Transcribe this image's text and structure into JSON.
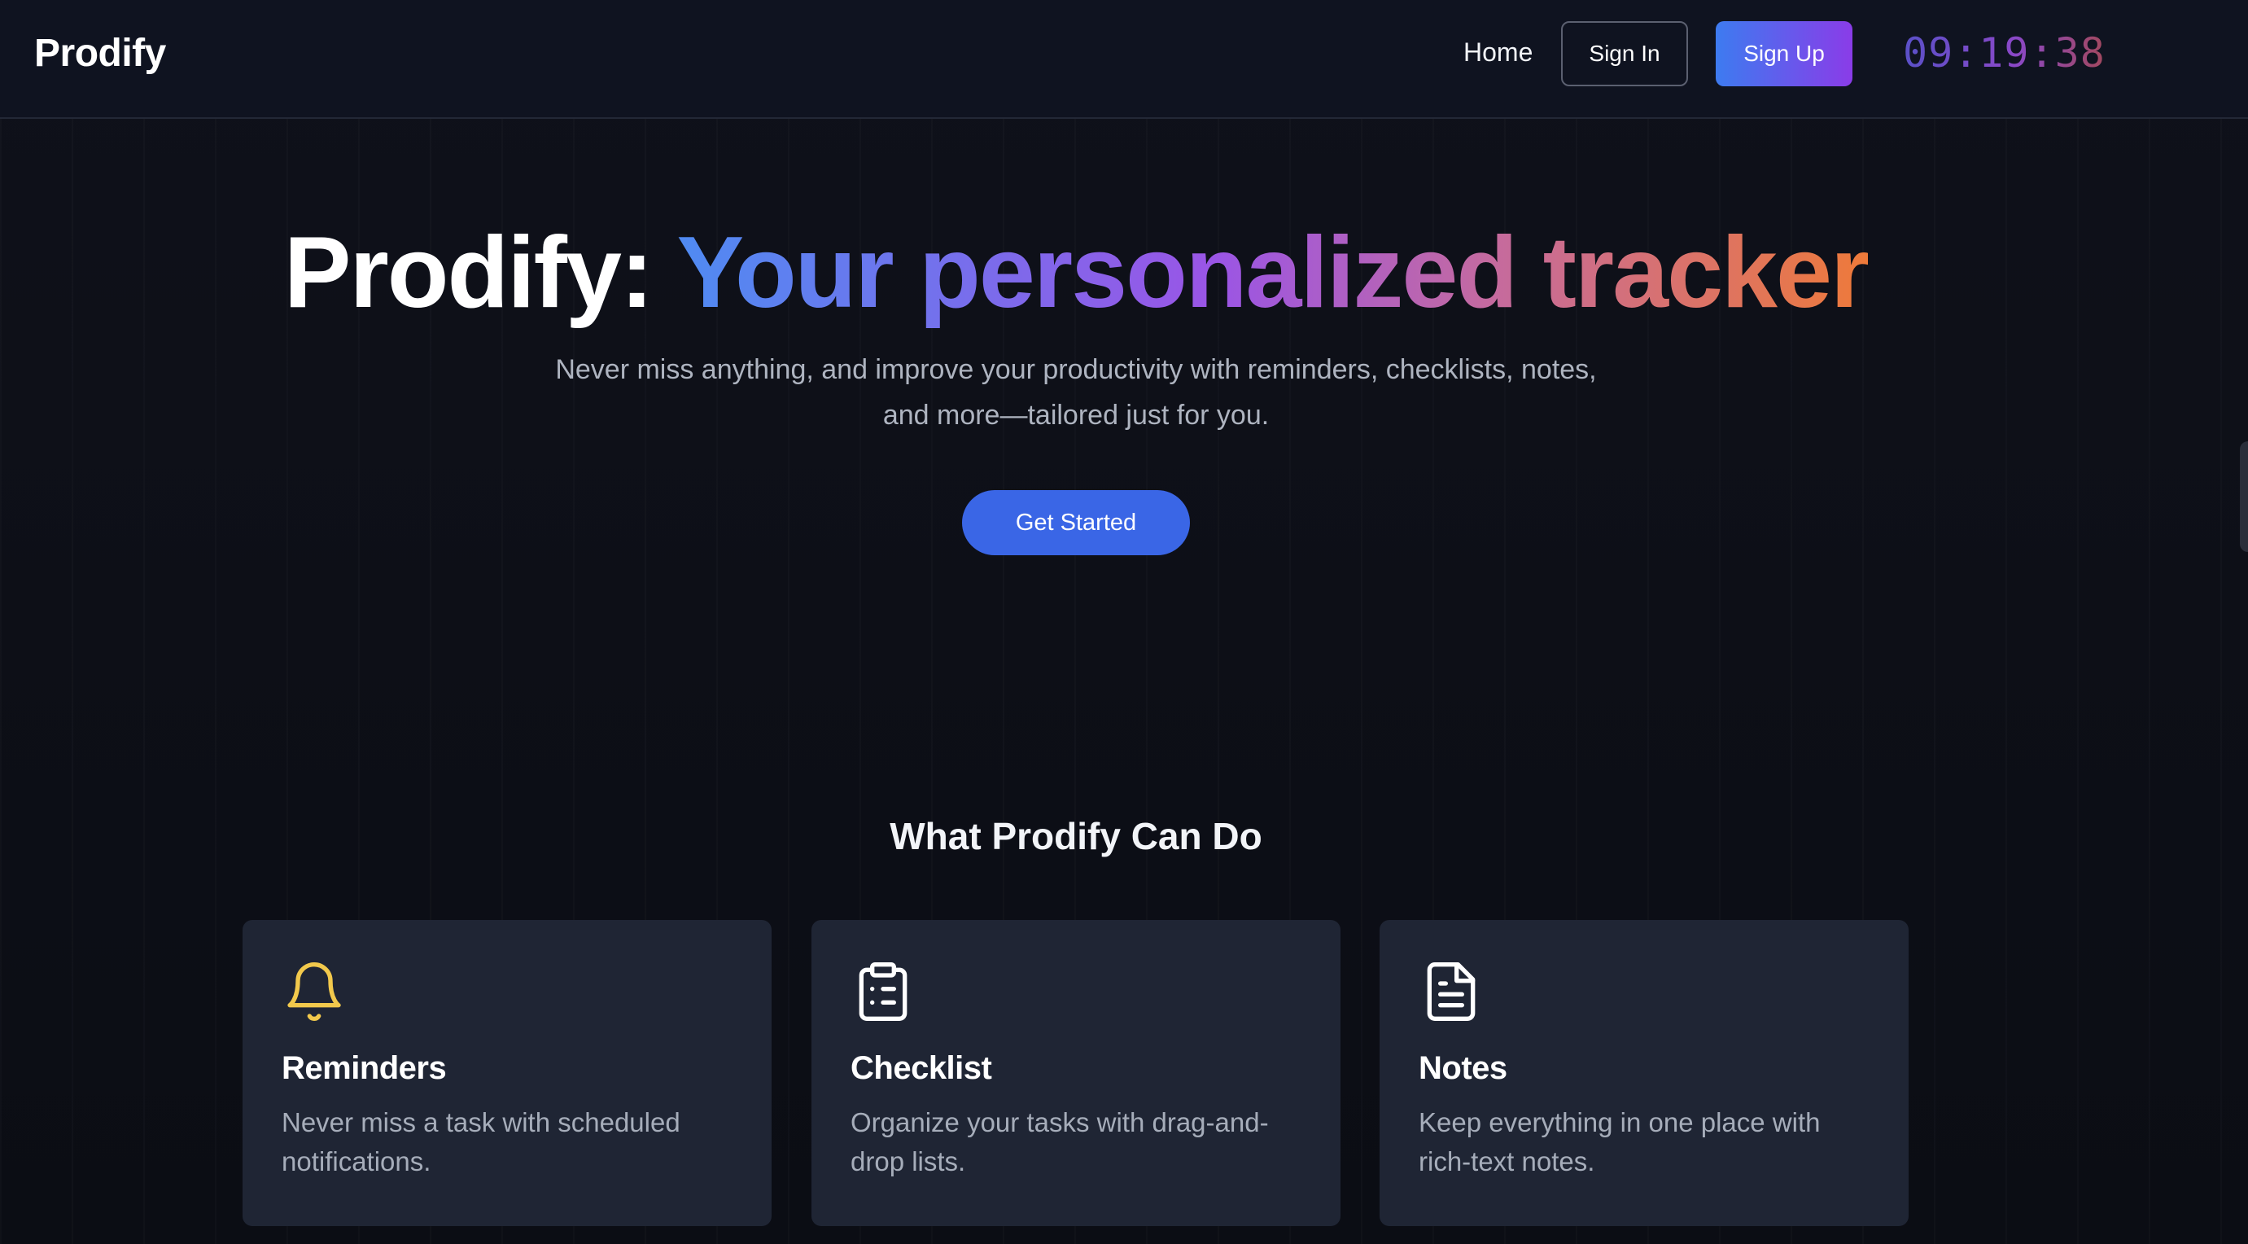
{
  "nav": {
    "brand": "Prodify",
    "home_label": "Home",
    "signin_label": "Sign In",
    "signup_label": "Sign Up",
    "clock": "09:19:38"
  },
  "hero": {
    "title_plain": "Prodify: ",
    "title_highlight": "Your personalized tracker",
    "subtitle": "Never miss anything, and improve your productivity with reminders, checklists, notes, and more—tailored just for you.",
    "cta_label": "Get Started"
  },
  "features": {
    "heading": "What Prodify Can Do",
    "cards": [
      {
        "icon": "bell-icon",
        "title": "Reminders",
        "description": "Never miss a task with scheduled notifications."
      },
      {
        "icon": "clipboard-list-icon",
        "title": "Checklist",
        "description": "Organize your tasks with drag-and-drop lists."
      },
      {
        "icon": "document-icon",
        "title": "Notes",
        "description": "Keep everything in one place with rich-text notes."
      }
    ]
  },
  "colors": {
    "background": "#0d0f16",
    "navbar": "#0f1320",
    "card": "#1f2534",
    "primary_button": "#3a66e6",
    "signup_gradient_start": "#3d7bf0",
    "signup_gradient_end": "#8a3ce8",
    "bell_icon": "#f2c94c"
  }
}
